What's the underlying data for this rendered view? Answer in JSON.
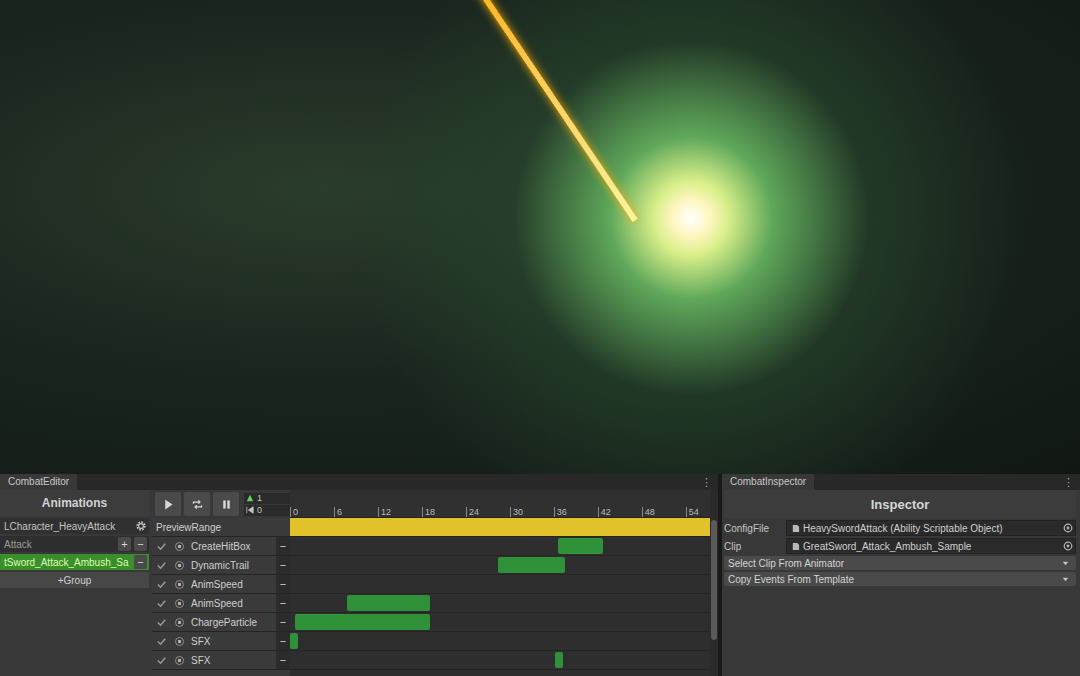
{
  "editor": {
    "tab": "CombatEditor",
    "menu": "⋮",
    "animations_title": "Animations",
    "character": "LCharacter_HeavyAttack",
    "add_label": "+",
    "remove_label": "−",
    "groups": [
      {
        "name": "Attack",
        "clips": [
          {
            "name": "tSword_Attack_Ambush_Sa",
            "selected": true
          }
        ]
      }
    ],
    "add_group": "+Group",
    "current_frame": "1",
    "start_frame": "0",
    "preview_range": {
      "label": "PreviewRange",
      "start": 0,
      "end": 57.3
    },
    "ruler": {
      "ticks": [
        "0",
        "6",
        "12",
        "18",
        "24",
        "30",
        "36",
        "42",
        "48",
        "54"
      ]
    },
    "tracks": [
      {
        "name": "CreateHitBox",
        "enabled": true,
        "visible": true,
        "clips": [
          {
            "start": 36.6,
            "end": 42.7
          }
        ]
      },
      {
        "name": "DynamicTrail",
        "enabled": true,
        "visible": true,
        "clips": [
          {
            "start": 28.4,
            "end": 37.5
          }
        ]
      },
      {
        "name": "AnimSpeed",
        "enabled": true,
        "visible": true,
        "clips": []
      },
      {
        "name": "AnimSpeed",
        "enabled": true,
        "visible": true,
        "clips": [
          {
            "start": 7.8,
            "end": 19.1
          }
        ]
      },
      {
        "name": "ChargeParticle",
        "enabled": true,
        "visible": true,
        "clips": [
          {
            "start": 0.7,
            "end": 19.1
          }
        ]
      },
      {
        "name": "SFX",
        "enabled": true,
        "visible": true,
        "clips": [
          {
            "start": 0,
            "end": 1.1
          }
        ]
      },
      {
        "name": "SFX",
        "enabled": true,
        "visible": true,
        "clips": [
          {
            "start": 36.1,
            "end": 37.2
          }
        ]
      }
    ]
  },
  "inspector": {
    "tab": "CombatInspector",
    "menu": "⋮",
    "title": "Inspector",
    "fields": [
      {
        "label": "ConfigFile",
        "value": "HeavySwordAttack (Ability Scriptable Object)"
      },
      {
        "label": "Clip",
        "value": "GreatSword_Attack_Ambush_Sample"
      }
    ],
    "dropdowns": [
      "Select Clip From Animator",
      "Copy Events From Template"
    ]
  }
}
